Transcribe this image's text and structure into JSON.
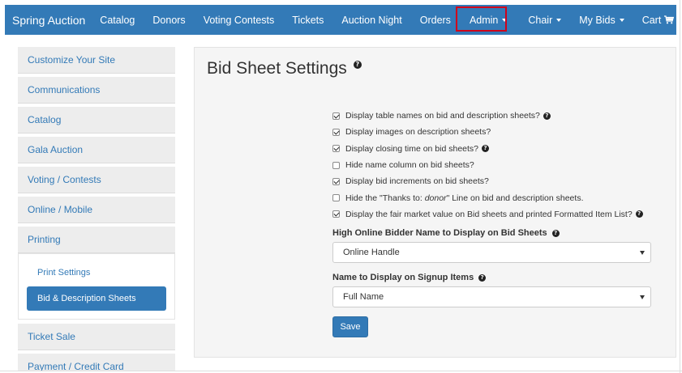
{
  "navbar": {
    "brand": "Spring Auction",
    "items": [
      {
        "label": "Catalog",
        "dropdown": false
      },
      {
        "label": "Donors",
        "dropdown": false
      },
      {
        "label": "Voting Contests",
        "dropdown": false
      },
      {
        "label": "Tickets",
        "dropdown": false
      },
      {
        "label": "Auction Night",
        "dropdown": false
      },
      {
        "label": "Orders",
        "dropdown": false
      },
      {
        "label": "Admin",
        "dropdown": true,
        "highlighted": true
      },
      {
        "label": "Chair",
        "dropdown": true
      },
      {
        "label": "My Bids",
        "dropdown": true
      },
      {
        "label": "Cart",
        "dropdown": false,
        "icon": "cart-icon"
      }
    ],
    "color": "#337ab7",
    "highlight_color": "#d0021b"
  },
  "sidebar": {
    "items": [
      {
        "label": "Customize Your Site"
      },
      {
        "label": "Communications"
      },
      {
        "label": "Catalog"
      },
      {
        "label": "Gala Auction"
      },
      {
        "label": "Voting / Contests"
      },
      {
        "label": "Online / Mobile"
      },
      {
        "label": "Printing"
      }
    ],
    "printing_subitems": [
      {
        "label": "Print Settings",
        "active": false
      },
      {
        "label": "Bid & Description Sheets",
        "active": true
      }
    ],
    "after_items": [
      {
        "label": "Ticket Sale"
      },
      {
        "label": "Payment / Credit Card"
      }
    ]
  },
  "main": {
    "title": "Bid Sheet Settings",
    "checkboxes": [
      {
        "label": "Display table names on bid and description sheets?",
        "checked": true,
        "help": true
      },
      {
        "label": "Display images on description sheets?",
        "checked": true,
        "help": false
      },
      {
        "label": "Display closing time on bid sheets?",
        "checked": true,
        "help": true
      },
      {
        "label": "Hide name column on bid sheets?",
        "checked": false,
        "help": false
      },
      {
        "label": "Display bid increments on bid sheets?",
        "checked": true,
        "help": false
      },
      {
        "label_prefix": "Hide the \"Thanks to: ",
        "label_em": "donor",
        "label_suffix": "\" Line on bid and description sheets.",
        "checked": false,
        "help": false
      },
      {
        "label": "Display the fair market value on Bid sheets and printed Formatted Item List?",
        "checked": true,
        "help": true
      }
    ],
    "high_bidder_label": "High Online Bidder Name to Display on Bid Sheets",
    "high_bidder_value": "Online Handle",
    "signup_label": "Name to Display on Signup Items",
    "signup_value": "Full Name",
    "save_label": "Save"
  }
}
